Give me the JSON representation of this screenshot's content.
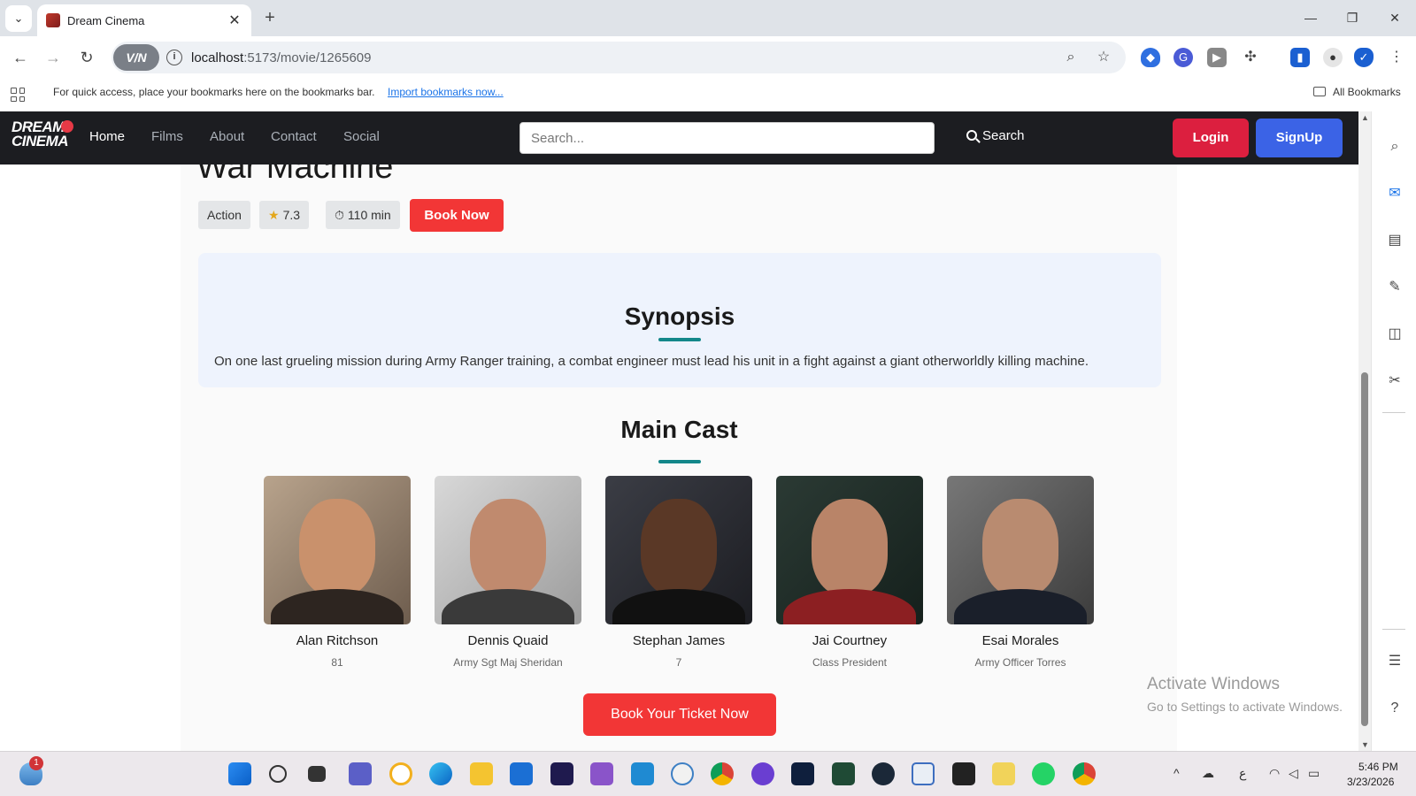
{
  "browser": {
    "tab_title": "Dream Cinema",
    "url_host": "localhost",
    "url_path": ":5173/movie/1265609",
    "vpn_label": "V/N",
    "bookmarks_text": "For quick access, place your bookmarks here on the bookmarks bar.",
    "bookmarks_link": "Import bookmarks now...",
    "all_bookmarks": "All Bookmarks"
  },
  "nav": {
    "logo_line1": "DREAM",
    "logo_line2": "CINEMA",
    "links": [
      "Home",
      "Films",
      "About",
      "Contact",
      "Social"
    ],
    "search_placeholder": "Search...",
    "search_button": "Search",
    "login": "Login",
    "signup": "SignUp"
  },
  "movie": {
    "title": "War Machine",
    "genre": "Action",
    "rating": "7.3",
    "runtime": "110 min",
    "book_now": "Book Now",
    "synopsis_heading": "Synopsis",
    "synopsis": "On one last grueling mission during Army Ranger training, a combat engineer must lead his unit in a fight against a giant otherworldly killing machine.",
    "cast_heading": "Main Cast",
    "cast": [
      {
        "name": "Alan Ritchson",
        "role": "81"
      },
      {
        "name": "Dennis Quaid",
        "role": "Army Sgt Maj Sheridan"
      },
      {
        "name": "Stephan James",
        "role": "7"
      },
      {
        "name": "Jai Courtney",
        "role": "Class President"
      },
      {
        "name": "Esai Morales",
        "role": "Army Officer Torres"
      }
    ],
    "book_ticket": "Book Your Ticket Now"
  },
  "watermark": {
    "activate_title": "Activate Windows",
    "activate_sub": "Go to Settings to activate Windows."
  },
  "taskbar": {
    "notification_count": "1",
    "time": "5:46 PM",
    "date": "3/23/2026"
  },
  "colors": {
    "nav_bg": "#1c1d21",
    "login": "#dc1f3f",
    "signup": "#3b63e6",
    "book": "#f23636",
    "accent_underline": "#13878a",
    "synopsis_bg": "#eef3fd"
  }
}
